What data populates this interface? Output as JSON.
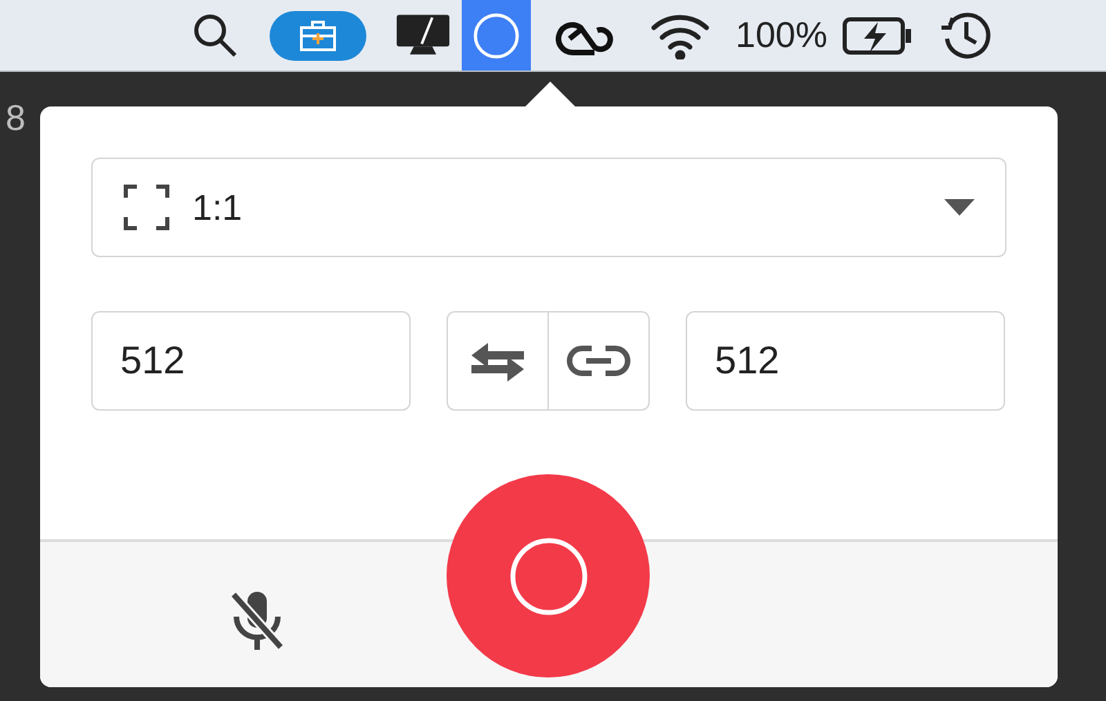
{
  "menu_bar": {
    "items": [
      {
        "kind": "search",
        "selected": false
      },
      {
        "kind": "toolbox",
        "selected": false
      },
      {
        "kind": "display",
        "selected": false
      },
      {
        "kind": "recorder",
        "selected": true
      },
      {
        "kind": "cloud",
        "selected": false
      },
      {
        "kind": "wifi",
        "selected": false
      },
      {
        "kind": "battery",
        "label": "100%",
        "selected": false
      },
      {
        "kind": "history",
        "selected": false
      }
    ]
  },
  "background_text": "8",
  "popover": {
    "aspect_dropdown": {
      "value": "1:1"
    },
    "width_field": {
      "value": "512"
    },
    "height_field": {
      "value": "512"
    },
    "microphone": {
      "muted": true
    }
  }
}
